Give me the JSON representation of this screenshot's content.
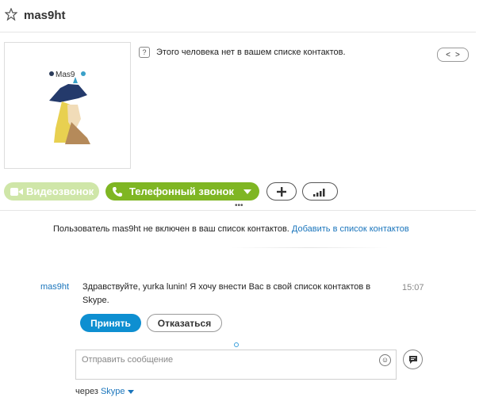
{
  "header": {
    "title": "mas9ht"
  },
  "profile": {
    "notice": "Этого человека нет в вашем списке контактов.",
    "avatar_text": "Mas9"
  },
  "actions": {
    "video_label": "Видеозвонок",
    "phone_label": "Телефонный звонок"
  },
  "system_message": {
    "text": "Пользователь mas9ht не включен в ваш список контактов.",
    "link": "Добавить в список контактов"
  },
  "message": {
    "sender": "mas9ht",
    "text": "Здравствуйте, yurka lunin! Я хочу внести Вас в свой список контактов в Skype.",
    "time": "15:07",
    "accept_label": "Принять",
    "decline_label": "Отказаться"
  },
  "composer": {
    "placeholder": "Отправить сообщение",
    "via_prefix": "через",
    "via_service": "Skype"
  },
  "colors": {
    "accent": "#0e8fd1",
    "call_green": "#7fb623",
    "video_disabled": "#cfe6a8",
    "link": "#1a75bc"
  }
}
